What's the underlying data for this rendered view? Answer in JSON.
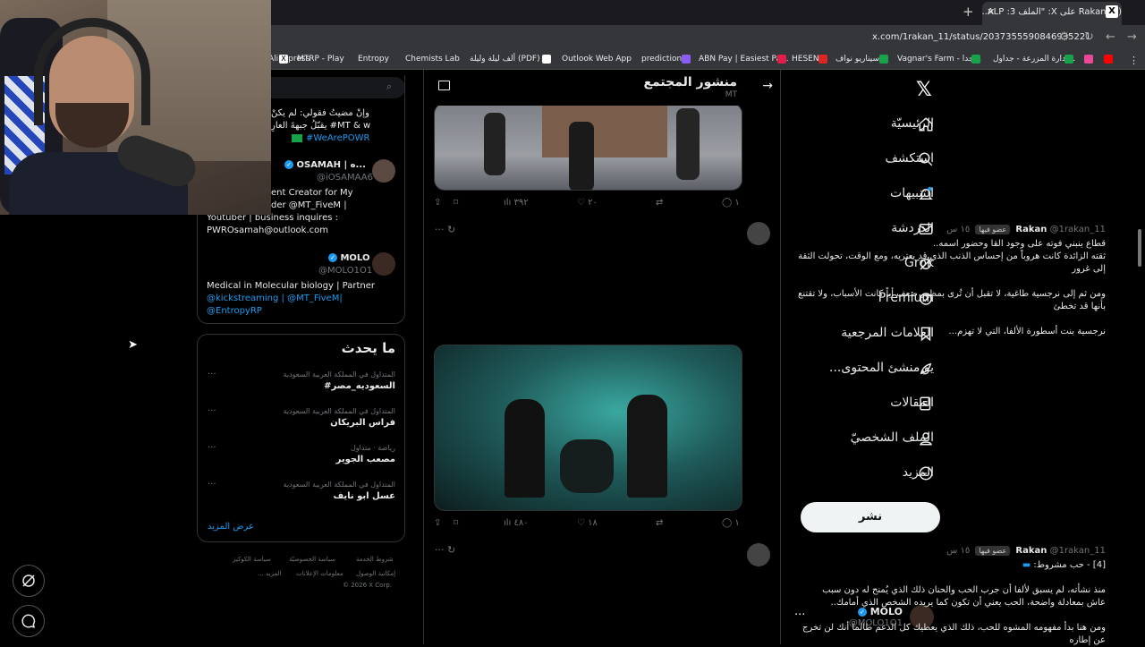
{
  "browser": {
    "tab_title": "(3) Rakan على X: \"الملف 3: ALP...",
    "url": "x.com/1rakan_11/status/2037355590846935221",
    "bookmarks": [
      "AliExpress",
      "MTRP - Play",
      "Entropy",
      "Chemists Lab",
      "ألف ليلة وليلة (PDF)",
      "Outlook Web App",
      "predictions",
      "ABN Pay | Easiest Pa...",
      "HESEN",
      "سيناريو نواف",
      "Vagnar's Farm - جدا...",
      "إدارة المزرعة - جداول..."
    ]
  },
  "sidebar": {
    "items": [
      {
        "label": "الرئيسيّة",
        "icon": "home-icon"
      },
      {
        "label": "استكشف",
        "icon": "search-icon"
      },
      {
        "label": "التنبيهات",
        "icon": "bell-icon"
      },
      {
        "label": "الدردشة",
        "icon": "mail-icon"
      },
      {
        "label": "Grok",
        "icon": "grok-icon"
      },
      {
        "label": "Premium",
        "icon": "premium-icon"
      },
      {
        "label": "العلامات المرجعية",
        "icon": "bookmark-icon"
      },
      {
        "label": "...يو منشئ المحتوى",
        "icon": "rocket-icon"
      },
      {
        "label": "المقالات",
        "icon": "articles-icon"
      },
      {
        "label": "الملف الشخصيّ",
        "icon": "profile-icon"
      },
      {
        "label": "المزيد",
        "icon": "more-icon"
      }
    ],
    "post_button": "نشر",
    "account": {
      "name": "MOLO",
      "handle": "@MOLO1O1"
    }
  },
  "header": {
    "title": "منشور المجتمع",
    "subtitle": "MT"
  },
  "tweets": [
    {
      "stats": {
        "replies": "١",
        "retweets": "",
        "likes": "٢٠",
        "views": "٣٩٢"
      }
    },
    {
      "name": "Rakan",
      "handle": "@1rakan_11",
      "badge": "عضو فيها",
      "time": "١٥ س",
      "lines": [
        "قطاع ينبني فوته على وجود القا وحضور اسمه..",
        "ثقته الزائدة كانت هروباً من إحساس الذنب الذي قد يعتريه، ومع الوقت، تحولت الثقة",
        "إلى غرور",
        "",
        "ومن ثم إلى نرجسية طاغية، لا تقبل أن تُرى بمظهر ضعف أياً كانت الأسباب، ولا تقتنع",
        "بأنها قد تخطئ",
        "",
        "نرجسية بنت أسطورة الألفا، التي لا تهزم..."
      ],
      "stats": {
        "replies": "١",
        "retweets": "",
        "likes": "١٨",
        "views": "٤٨٠"
      }
    },
    {
      "name": "Rakan",
      "handle": "@1rakan_11",
      "badge": "عضو فيها",
      "time": "١٥ س",
      "lines": [
        "[4] - حب مشروط:",
        "",
        "منذ نشأته، لم يسبق لألفا أن جرب الحب والحنان ذلك الذي يُمنح له دون سبب",
        "عاش بمعادلة واضحة، الحب يعني أن تكون كما يريده الشخص الذي أمامك..",
        "",
        "ومن هنا بدأ مفهومه المشوه للحب، ذلك الذي يعطيك كل الدعم طالما أنك لن تخرج",
        "عن إطاره"
      ]
    }
  ],
  "who_to_follow": {
    "top_lines": [
      "وإنْ مضيتُ فقولي: لم يكنْ",
      "يقبّلُ جبهةَ العارِ #MT & w",
      "#WeArePOWR"
    ],
    "users": [
      {
        "name": "OSAMAH | ه...",
        "handle": "@iOSAMAA6",
        "bio": [
          "ent Creator for My",
          "der @MT_FiveM |",
          "Youtuber | business inquires :",
          "PWROsamah@outlook.com"
        ]
      },
      {
        "name": "MOLO",
        "handle": "@MOLO1O1",
        "bio": [
          "Medical in Molecular biology | Partner",
          "@kickstreaming | @MT_FiveM|",
          "@EntropyRP"
        ]
      }
    ]
  },
  "trends": {
    "title": "ما يحدث",
    "items": [
      {
        "meta": "المتداول في المملكة العربية السعودية",
        "name": "#السعوديه_مصر"
      },
      {
        "meta": "المتداول في المملكة العربية السعودية",
        "name": "فراس البريكان"
      },
      {
        "meta": "رياضة · متداول",
        "name": "مصعب الجوير"
      },
      {
        "meta": "المتداول في المملكة العربية السعودية",
        "name": "عسل ابو نايف"
      }
    ],
    "show_more": "عرض المزيد"
  },
  "footer": {
    "row1": [
      "شروط الخدمة",
      "سياسة الخصوصيّة",
      "سياسة الكوكيز"
    ],
    "row2": [
      "إمكانية الوصول",
      "معلومات الإعلانات",
      "... المزيد"
    ],
    "copyright": "© 2026 X Corp."
  },
  "colors": {
    "accent": "#1d9bf0",
    "background": "#000000",
    "post_button": "#eff3f4"
  }
}
